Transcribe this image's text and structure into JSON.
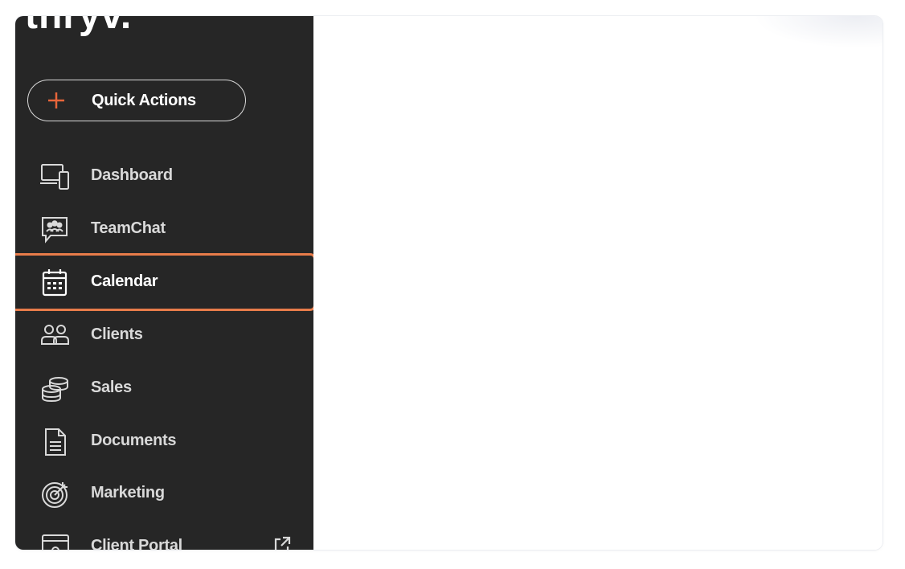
{
  "brand": {
    "logo_text": "thryv."
  },
  "quick_actions": {
    "label": "Quick Actions",
    "plus_color": "#e8653a"
  },
  "nav": {
    "items": [
      {
        "label": "Dashboard",
        "icon": "dashboard-icon"
      },
      {
        "label": "TeamChat",
        "icon": "teamchat-icon"
      },
      {
        "label": "Calendar",
        "icon": "calendar-icon",
        "active": true
      },
      {
        "label": "Clients",
        "icon": "clients-icon"
      },
      {
        "label": "Sales",
        "icon": "sales-icon"
      },
      {
        "label": "Documents",
        "icon": "documents-icon"
      },
      {
        "label": "Marketing",
        "icon": "marketing-icon"
      },
      {
        "label": "Client Portal",
        "icon": "client-portal-icon",
        "external": true
      }
    ]
  },
  "colors": {
    "sidebar_bg": "#262626",
    "highlight": "#e87c4a",
    "text": "#ffffff"
  }
}
